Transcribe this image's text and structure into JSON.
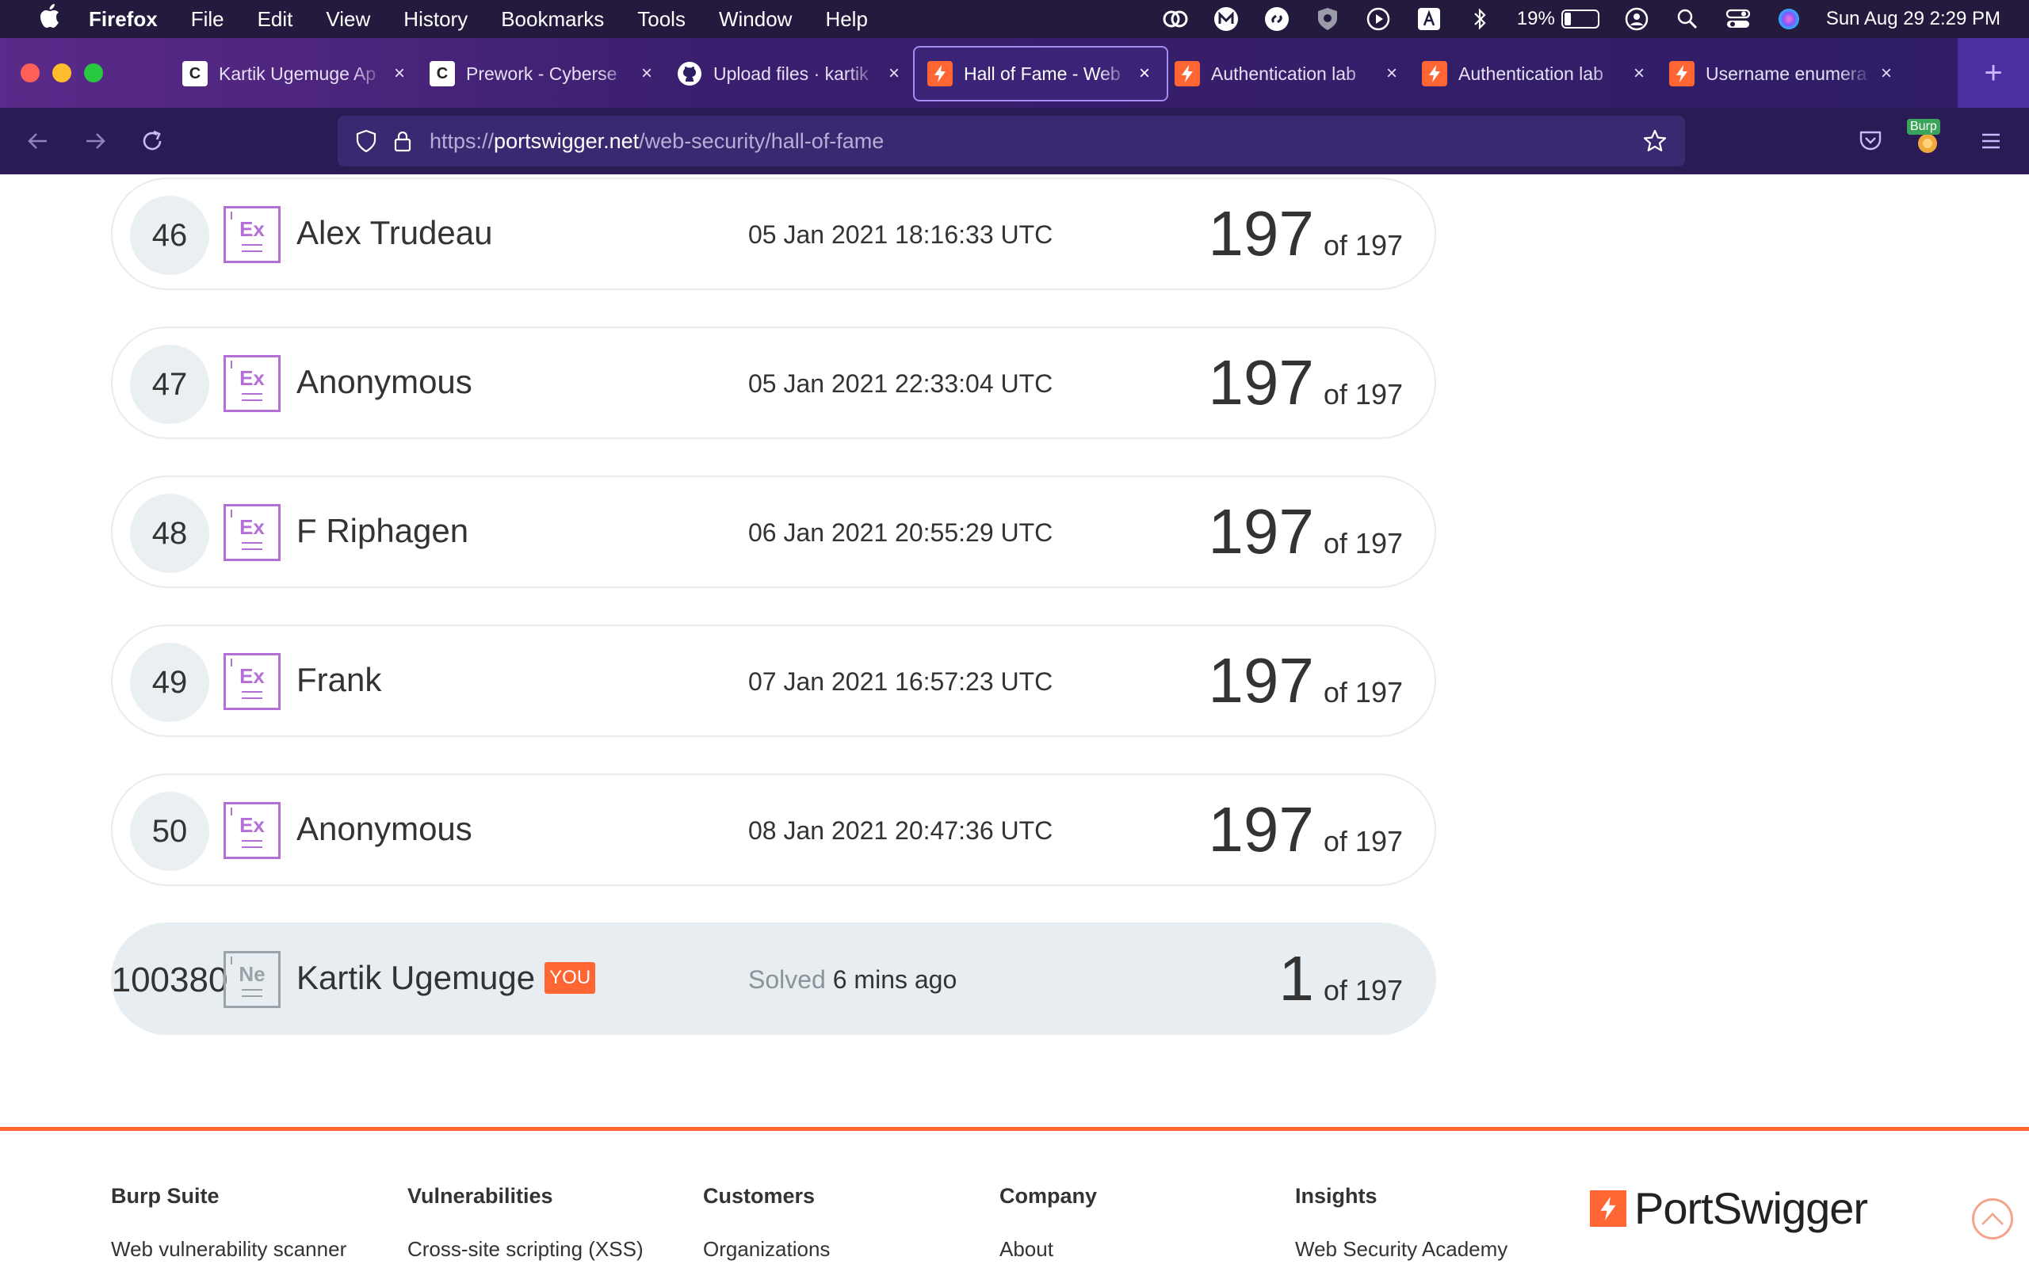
{
  "menubar": {
    "apple": "",
    "items": [
      "Firefox",
      "File",
      "Edit",
      "View",
      "History",
      "Bookmarks",
      "Tools",
      "Window",
      "Help"
    ],
    "battery_percent": "19%",
    "battery_level": 0.19,
    "datetime": "Sun Aug 29  2:29 PM"
  },
  "tabs": [
    {
      "title": "Kartik Ugemuge Ap",
      "favicon": "c",
      "active": false
    },
    {
      "title": "Prework - Cyberse",
      "favicon": "c",
      "active": false
    },
    {
      "title": "Upload files · kartik",
      "favicon": "github",
      "active": false
    },
    {
      "title": "Hall of Fame - Web",
      "favicon": "portswigger",
      "active": true
    },
    {
      "title": "Authentication lab",
      "favicon": "portswigger",
      "active": false
    },
    {
      "title": "Authentication lab",
      "favicon": "portswigger",
      "active": false
    },
    {
      "title": "Username enumera",
      "favicon": "portswigger",
      "active": false
    }
  ],
  "newtab_label": "+",
  "address": {
    "scheme": "https://",
    "host": "portswigger.net",
    "path": "/web-security/hall-of-fame"
  },
  "toolbar": {
    "burp_label": "Burp"
  },
  "leaderboard": [
    {
      "rank": "46",
      "badge": "Ex",
      "name": "Alex Trudeau",
      "date": "05 Jan 2021 18:16:33 UTC",
      "score": "197",
      "of": "of 197"
    },
    {
      "rank": "47",
      "badge": "Ex",
      "name": "Anonymous",
      "date": "05 Jan 2021 22:33:04 UTC",
      "score": "197",
      "of": "of 197"
    },
    {
      "rank": "48",
      "badge": "Ex",
      "name": "F Riphagen",
      "date": "06 Jan 2021 20:55:29 UTC",
      "score": "197",
      "of": "of 197"
    },
    {
      "rank": "49",
      "badge": "Ex",
      "name": "Frank",
      "date": "07 Jan 2021 16:57:23 UTC",
      "score": "197",
      "of": "of 197"
    },
    {
      "rank": "50",
      "badge": "Ex",
      "name": "Anonymous",
      "date": "08 Jan 2021 20:47:36 UTC",
      "score": "197",
      "of": "of 197"
    }
  ],
  "current_user": {
    "rank": "100380",
    "badge": "Ne",
    "name": "Kartik Ugemuge",
    "you_tag": "YOU",
    "solved_label": "Solved",
    "solved_when": "6 mins ago",
    "score": "1",
    "of": "of 197"
  },
  "footer": {
    "columns": [
      {
        "heading": "Burp Suite",
        "link": "Web vulnerability scanner"
      },
      {
        "heading": "Vulnerabilities",
        "link": "Cross-site scripting (XSS)"
      },
      {
        "heading": "Customers",
        "link": "Organizations"
      },
      {
        "heading": "Company",
        "link": "About"
      },
      {
        "heading": "Insights",
        "link": "Web Security Academy"
      }
    ],
    "brand": "PortSwigger"
  },
  "colors": {
    "accent": "#ff6633",
    "expert_badge": "#b46fd6",
    "novice_badge": "#9aa3a8",
    "menubar_bg": "#231a3e",
    "navbar_bg": "#2b1b55"
  }
}
